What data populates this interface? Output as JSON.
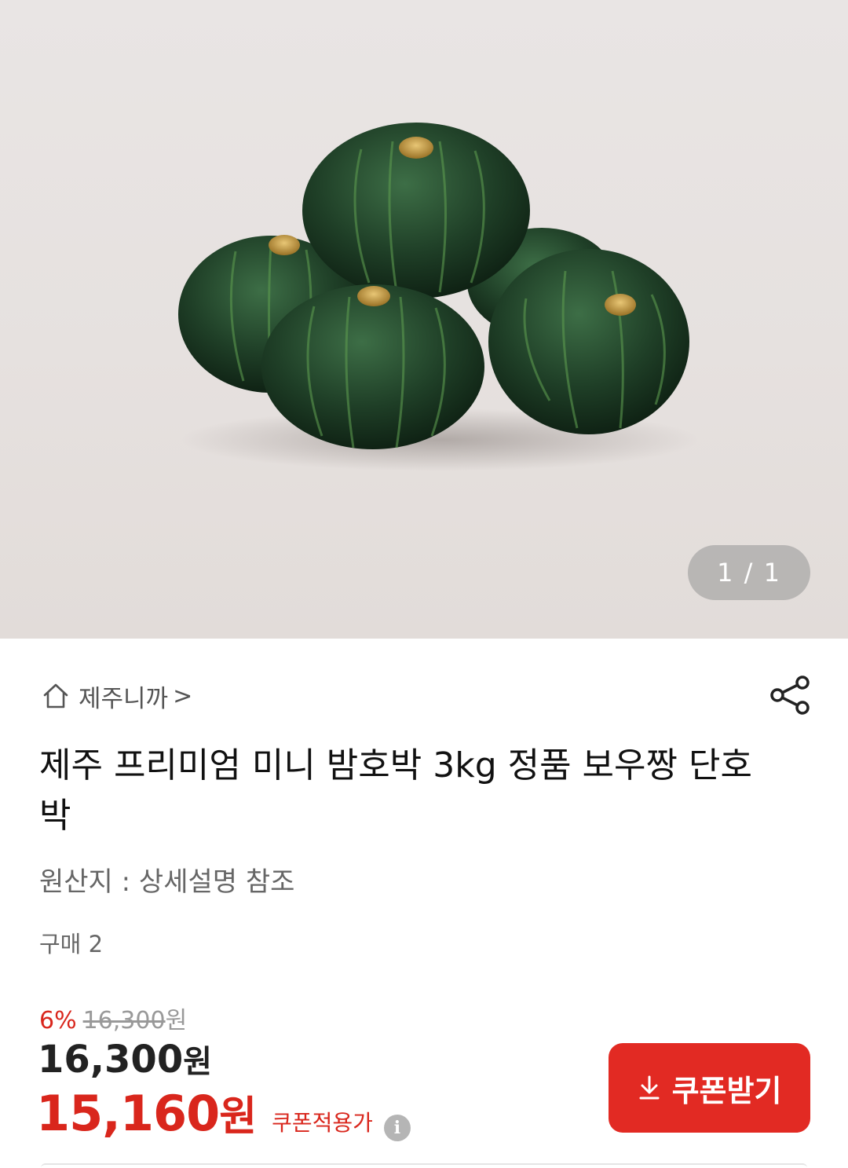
{
  "gallery": {
    "image_label": "pumpkin-product-image",
    "counter": "1 / 1"
  },
  "store": {
    "icon": "home-icon",
    "name": "제주니까",
    "chevron": ">"
  },
  "share": {
    "icon": "share-icon"
  },
  "product": {
    "title": "제주 프리미엄 미니 밤호박 3kg 정품 보우짱 단호박",
    "origin": "원산지 : 상세설명 참조",
    "purchase_count": "구매 2"
  },
  "price": {
    "discount_percent": "6%",
    "original_price": "16,300",
    "original_unit": "원",
    "sale_price": "16,300",
    "sale_unit": "원",
    "coupon_price": "15,160",
    "coupon_unit": "원",
    "coupon_label": "쿠폰적용가",
    "info_icon": "i"
  },
  "coupon_button": {
    "icon": "download-icon",
    "label": "쿠폰받기"
  },
  "colors": {
    "accent_red": "#e22a23",
    "price_red": "#d9261c"
  }
}
